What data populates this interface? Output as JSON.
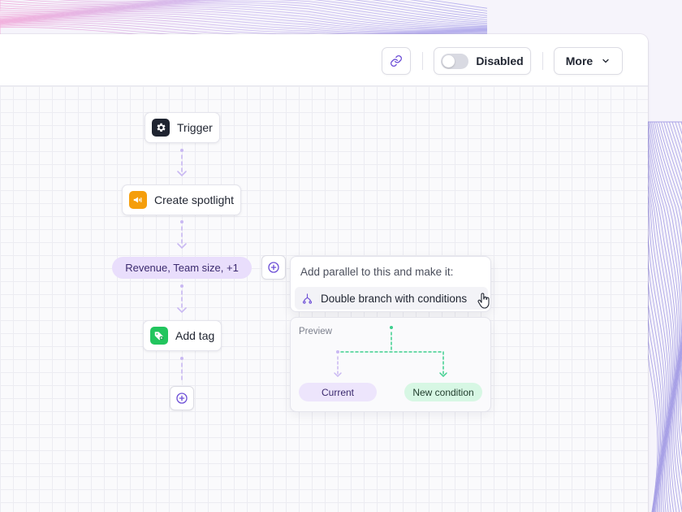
{
  "toolbar": {
    "link_icon": "link-icon",
    "status_label": "Disabled",
    "status_enabled": false,
    "more_label": "More"
  },
  "flow": {
    "trigger_label": "Trigger",
    "spotlight_label": "Create spotlight",
    "condition_label": "Revenue, Team size, +1",
    "tag_label": "Add tag"
  },
  "popover": {
    "title": "Add parallel to this and make it:",
    "option_label": "Double branch with conditions"
  },
  "preview": {
    "label": "Preview",
    "current_label": "Current",
    "new_label": "New condition"
  },
  "colors": {
    "accent": "#6d4fd6",
    "connector": "#c9b8f2",
    "green": "#3ecf8e",
    "spotlight": "#f59e0b",
    "tag": "#22c55e",
    "dark": "#1f2430",
    "condition_pill": "#e9defc",
    "new_pill": "#d7f7e4"
  }
}
